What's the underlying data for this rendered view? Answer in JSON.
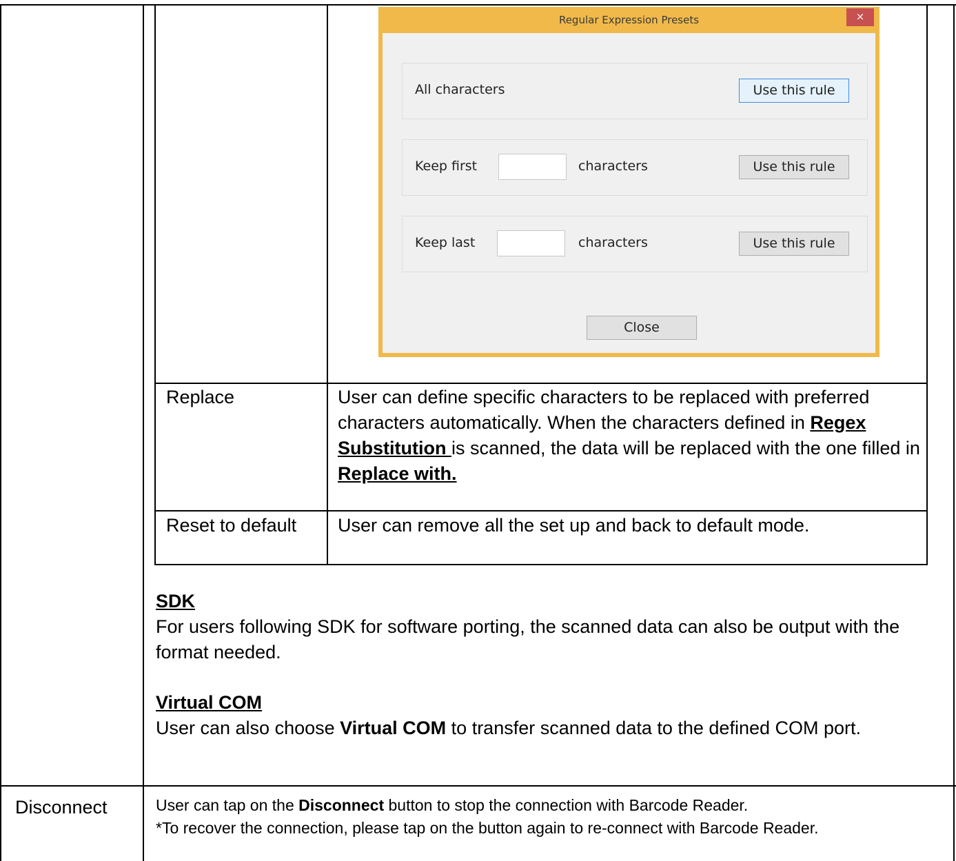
{
  "dialog": {
    "title": "Regular Expression Presets",
    "close_glyph": "×",
    "rules": [
      {
        "label": "All characters",
        "button": "Use this rule"
      },
      {
        "label": "Keep first",
        "suffix": "characters",
        "input_value": "",
        "button": "Use this rule"
      },
      {
        "label": "Keep last",
        "suffix": "characters",
        "input_value": "",
        "button": "Use this rule"
      }
    ],
    "close_button": "Close"
  },
  "table_rows": [
    {
      "name": "Replace",
      "desc_1": "User can define specific characters to be replaced with preferred characters automatically. When the characters defined in ",
      "desc_bold_1": "Regex Substitution ",
      "desc_2": "is scanned, the data will be replaced with the one filled in ",
      "desc_bold_2": "Replace with."
    },
    {
      "name": "Reset to default",
      "desc": "User can remove all the set up and back to default mode."
    }
  ],
  "sdk": {
    "heading": "SDK",
    "text": "For users following SDK for software porting, the scanned data can also be output with the format needed."
  },
  "virtual_com": {
    "heading": "Virtual COM",
    "text_1": "User can also choose ",
    "text_bold": "Virtual COM",
    "text_2": " to transfer scanned data to the defined COM port."
  },
  "disconnect": {
    "name": "Disconnect",
    "text_1": "User can tap on the ",
    "text_bold": "Disconnect",
    "text_2": " button to stop the connection with Barcode Reader.",
    "text_3": "*To recover the connection, please tap on the button again to re-connect with Barcode Reader."
  }
}
